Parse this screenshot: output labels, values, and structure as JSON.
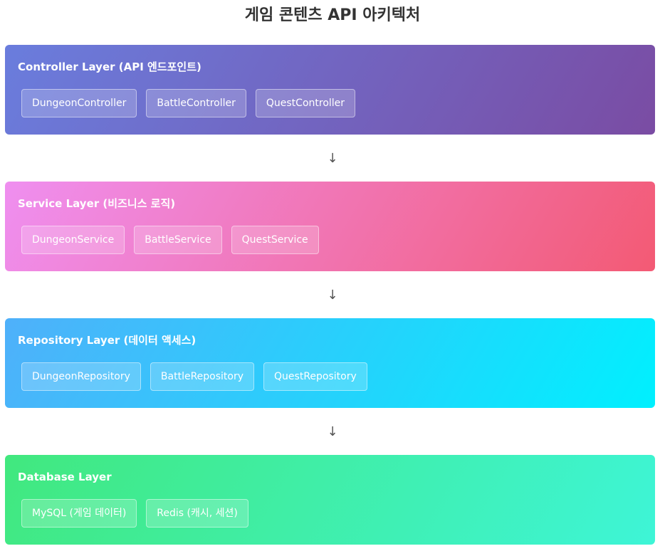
{
  "title": "게임 콘텐츠 API 아키텍처",
  "arrow_symbol": "↓",
  "layers": [
    {
      "title": "Controller Layer (API 엔드포인트)",
      "components": [
        "DungeonController",
        "BattleController",
        "QuestController"
      ]
    },
    {
      "title": "Service Layer (비즈니스 로직)",
      "components": [
        "DungeonService",
        "BattleService",
        "QuestService"
      ]
    },
    {
      "title": "Repository Layer (데이터 액세스)",
      "components": [
        "DungeonRepository",
        "BattleRepository",
        "QuestRepository"
      ]
    },
    {
      "title": "Database Layer",
      "components": [
        "MySQL (게임 데이터)",
        "Redis (캐시, 세션)"
      ]
    }
  ]
}
